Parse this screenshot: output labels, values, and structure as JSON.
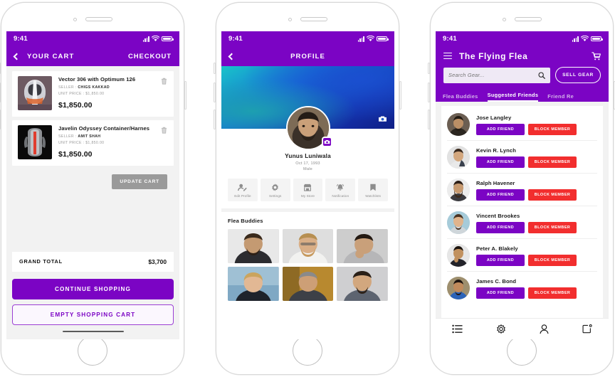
{
  "phones": {
    "cart": {
      "status_bar": {
        "time": "9:41",
        "signal_icon": "signal-bars-icon",
        "wifi_icon": "wifi-icon",
        "battery_icon": "battery-icon"
      },
      "nav": {
        "back_icon": "chevron-left-icon",
        "title": "YOUR CART",
        "action": "CHECKOUT"
      },
      "items": [
        {
          "thumb": "helmet-thumbnail",
          "title": "Vector 306 with Optimum 126",
          "seller_label": "SELLER :",
          "seller": "CHIGS KAKKAD",
          "unit_price_label": "UNIT PRICE :",
          "unit_price": "$1,850.00",
          "price": "$1,850.00",
          "delete_icon": "trash-icon"
        },
        {
          "thumb": "harness-thumbnail",
          "title": "Javelin Odyssey Container/Harnes",
          "seller_label": "SELLER :",
          "seller": "AMIT SHAH",
          "unit_price_label": "UNIT PRICE :",
          "unit_price": "$1,850.00",
          "price": "$1,850.00",
          "delete_icon": "trash-icon"
        }
      ],
      "update_label": "UPDATE CART",
      "grand_total_label": "GRAND TOTAL",
      "grand_total_value": "$3,700",
      "continue_label": "CONTINUE SHOPPING",
      "empty_label": "EMPTY SHOPPING CART"
    },
    "profile": {
      "status_bar": {
        "time": "9:41",
        "signal_icon": "signal-bars-icon",
        "wifi_icon": "wifi-icon",
        "battery_icon": "battery-icon"
      },
      "nav": {
        "back_icon": "chevron-left-icon",
        "title": "PROFILE"
      },
      "cover_camera_icon": "camera-icon",
      "avatar_camera_icon": "camera-icon",
      "name": "Yunus Luniwala",
      "dob": "Oct 17, 1993",
      "gender": "Male",
      "actions": [
        {
          "icon": "edit-profile-icon",
          "label": "Edit Profile"
        },
        {
          "icon": "gear-icon",
          "label": "Settings"
        },
        {
          "icon": "store-icon",
          "label": "My Store"
        },
        {
          "icon": "bell-icon",
          "label": "Notification"
        },
        {
          "icon": "bookmark-icon",
          "label": "Watchlists"
        }
      ],
      "buddies_title": "Flea Buddies",
      "buddies": [
        "buddy-photo-1",
        "buddy-photo-2",
        "buddy-photo-3",
        "buddy-photo-4",
        "buddy-photo-5",
        "buddy-photo-6"
      ]
    },
    "flea": {
      "status_bar": {
        "time": "9:41",
        "signal_icon": "signal-bars-icon",
        "wifi_icon": "wifi-icon",
        "battery_icon": "battery-icon"
      },
      "menu_icon": "hamburger-menu-icon",
      "logo": "The Flying Flea",
      "cart_icon": "shopping-cart-icon",
      "search": {
        "placeholder": "Search Gear...",
        "value": "",
        "icon": "search-icon"
      },
      "sell_label": "SELL GEAR",
      "tabs": [
        {
          "label": "Flea Buddies",
          "active": false
        },
        {
          "label": "Suggested Friends",
          "active": true
        },
        {
          "label": "Friend Re",
          "active": false
        }
      ],
      "friends": [
        {
          "name": "Jose Langley",
          "avatar": "friend-avatar-1",
          "add_label": "ADD FRIEND",
          "block_label": "BLOCK MEMBER"
        },
        {
          "name": "Kevin R. Lynch",
          "avatar": "friend-avatar-2",
          "add_label": "ADD FRIEND",
          "block_label": "BLOCK MEMBER"
        },
        {
          "name": "Ralph Havener",
          "avatar": "friend-avatar-3",
          "add_label": "ADD FRIEND",
          "block_label": "BLOCK MEMBER"
        },
        {
          "name": "Vincent Brookes",
          "avatar": "friend-avatar-4",
          "add_label": "ADD FRIEND",
          "block_label": "BLOCK MEMBER"
        },
        {
          "name": "Peter A. Blakely",
          "avatar": "friend-avatar-5",
          "add_label": "ADD FRIEND",
          "block_label": "BLOCK MEMBER"
        },
        {
          "name": "James C. Bond",
          "avatar": "friend-avatar-6",
          "add_label": "ADD FRIEND",
          "block_label": "BLOCK MEMBER"
        }
      ],
      "bottom_nav": [
        {
          "icon": "list-icon"
        },
        {
          "icon": "gear-icon"
        },
        {
          "icon": "person-icon"
        },
        {
          "icon": "notification-square-icon"
        }
      ]
    }
  },
  "colors": {
    "brand_purple": "#7B04C4",
    "danger_red": "#F22E2E",
    "screen_bg": "#F2F2F2",
    "muted_gray": "#9A9A9A"
  }
}
